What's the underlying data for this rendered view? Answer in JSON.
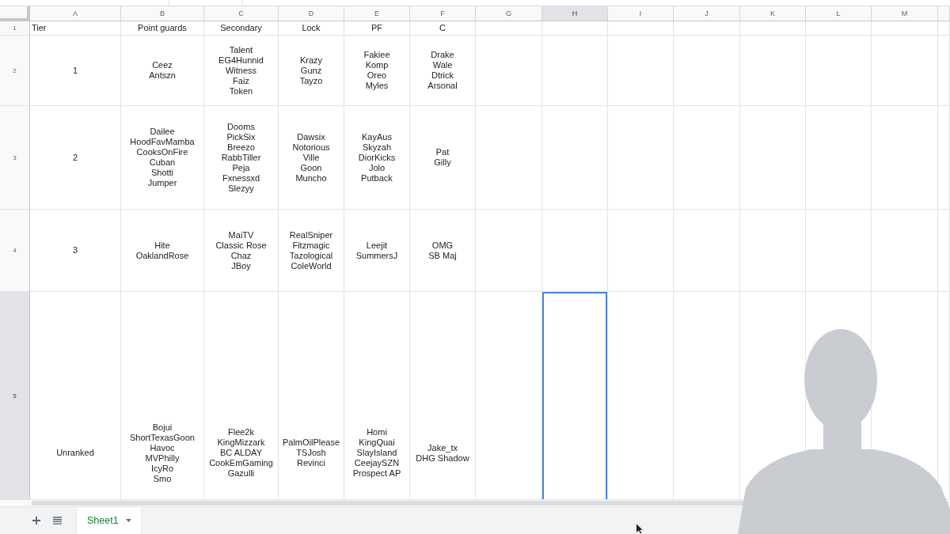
{
  "sheet": {
    "columns": [
      {
        "label": "A",
        "selected": false
      },
      {
        "label": "B",
        "selected": false
      },
      {
        "label": "C",
        "selected": false
      },
      {
        "label": "D",
        "selected": false
      },
      {
        "label": "E",
        "selected": false
      },
      {
        "label": "F",
        "selected": false
      },
      {
        "label": "G",
        "selected": false
      },
      {
        "label": "H",
        "selected": true
      },
      {
        "label": "I",
        "selected": false
      },
      {
        "label": "J",
        "selected": false
      },
      {
        "label": "K",
        "selected": false
      },
      {
        "label": "L",
        "selected": false
      },
      {
        "label": "M",
        "selected": false
      }
    ],
    "rows": [
      {
        "label": "1",
        "selected": false,
        "cells": [
          "Tier",
          "Point guards",
          "Secondary",
          "Lock",
          "PF",
          "C"
        ]
      },
      {
        "label": "2",
        "selected": false,
        "cells": [
          "1",
          "Ceez\nAntszn",
          "Talent\nEG4Hunnid\nWitness\nFaiz\nToken",
          "Krazy\nGunz\nTayzo",
          "Fakiee\nKomp\nOreo\nMyles",
          "Drake\nWale\nDtrick\nArsonal"
        ]
      },
      {
        "label": "3",
        "selected": false,
        "cells": [
          "2",
          "Dailee\nHoodFavMamba\nCooksOnFire\nCuban\nShotti\nJumper",
          "Dooms\nPickSix\nBreezo\nRabbTiller\nPeja\nFxnessxd\nSlezyy",
          "Dawsix\nNotorious\nVille\nGoon\nMuncho",
          "KayAus\nSkyzah\nDiorKicks\nJolo\nPutback",
          "Pat\nGilly"
        ]
      },
      {
        "label": "4",
        "selected": false,
        "cells": [
          "3",
          "Hite\nOaklandRose",
          "MaiTV\nClassic Rose\nChaz\nJBoy",
          "RealSniper\nFitzmagic\nTazological\nColeWorld",
          "Leejit\nSummersJ",
          "OMG\nSB Maj"
        ]
      },
      {
        "label": "5",
        "selected": true,
        "cells": [
          "Unranked",
          "Bojui\nShortTexasGoon\nHavoc\nMVPhilly\nIcyRo\nSmo",
          "Flee2k\nKingMizzark\nBC ALDAY\nCookEmGaming\nGazulli",
          "PalmOilPlease\nTSJosh\nRevinci",
          "Homi\nKingQuai\nSlayIsland\nCeejaySZN\nProspect AP",
          "Jake_tx\nDHG Shadow"
        ]
      }
    ]
  },
  "sheet_tabs": [
    {
      "label": "Sheet1",
      "selected": true
    }
  ]
}
